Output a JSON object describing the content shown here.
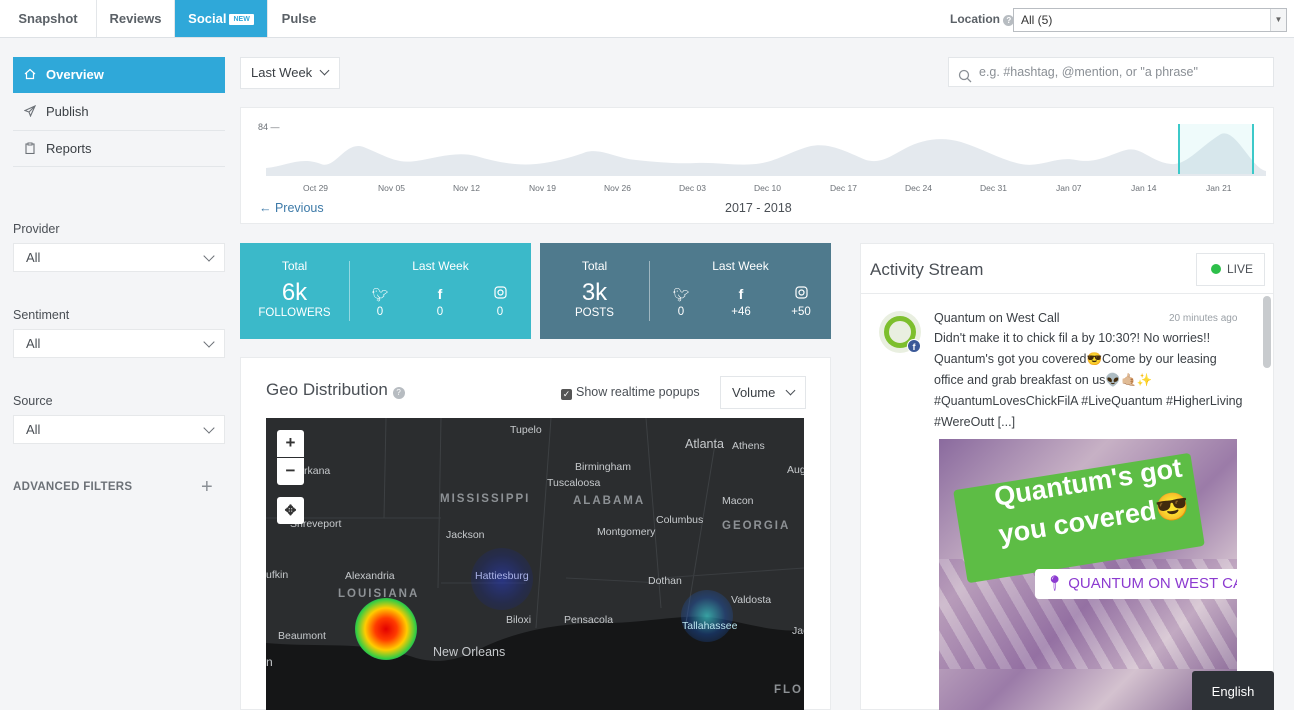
{
  "top_nav": {
    "tabs": [
      {
        "label": "Snapshot"
      },
      {
        "label": "Reviews"
      },
      {
        "label": "Social",
        "badge": "NEW"
      },
      {
        "label": "Pulse"
      }
    ],
    "active_tab": "Social",
    "location_label": "Location",
    "location_value": "All (5)"
  },
  "sidebar": {
    "items": [
      {
        "label": "Overview",
        "icon": "home-icon"
      },
      {
        "label": "Publish",
        "icon": "paper-plane-icon"
      },
      {
        "label": "Reports",
        "icon": "clipboard-icon"
      }
    ],
    "filters": [
      {
        "label": "Provider",
        "value": "All"
      },
      {
        "label": "Sentiment",
        "value": "All"
      },
      {
        "label": "Source",
        "value": "All"
      }
    ],
    "advanced_filters": "ADVANCED FILTERS"
  },
  "toolbar": {
    "period": "Last Week",
    "search_placeholder": "e.g. #hashtag, @mention, or \"a phrase\""
  },
  "timeline": {
    "y_max_label": "84",
    "dates": [
      "Oct 29",
      "Nov 05",
      "Nov 12",
      "Nov 19",
      "Nov 26",
      "Dec 03",
      "Dec 10",
      "Dec 17",
      "Dec 24",
      "Dec 31",
      "Jan 07",
      "Jan 14",
      "Jan 21"
    ],
    "previous": "← Previous",
    "range": "2017 - 2018"
  },
  "followers_card": {
    "total_label": "Total",
    "total_value": "6k",
    "total_unit": "FOLLOWERS",
    "last_week_label": "Last Week",
    "twitter": "0",
    "facebook": "0",
    "instagram": "0",
    "color": "#3bb9c9"
  },
  "posts_card": {
    "total_label": "Total",
    "total_value": "3k",
    "total_unit": "POSTS",
    "last_week_label": "Last Week",
    "twitter": "0",
    "facebook": "+46",
    "instagram": "+50",
    "color": "#4f7a8d"
  },
  "geo": {
    "title": "Geo Distribution",
    "show_popups": "Show realtime popups",
    "metric": "Volume",
    "labels": {
      "tupelo": "Tupelo",
      "atlanta": "Atlanta",
      "athens": "Athens",
      "birmingham": "Birmingham",
      "tuscaloosa": "Tuscaloosa",
      "arkana": "rkana",
      "mississippi": "MISSISSIPPI",
      "alabama": "ALABAMA",
      "macon": "Macon",
      "aug": "Aug",
      "shreveport": "Shreveport",
      "jackson": "Jackson",
      "montgomery": "Montgomery",
      "columbus": "Columbus",
      "georgia": "GEORGIA",
      "ufkin": "ufkin",
      "alexandria": "Alexandria",
      "hattiesburg": "Hattiesburg",
      "dothan": "Dothan",
      "louisiana": "LOUISIANA",
      "valdosta": "Valdosta",
      "beaumont": "Beaumont",
      "biloxi": "Biloxi",
      "pensacola": "Pensacola",
      "tallahassee": "Tallahassee",
      "jac": "Jac",
      "new_orleans": "New Orleans",
      "flo": "FLO",
      "n": "n"
    }
  },
  "activity": {
    "title": "Activity Stream",
    "live": "LIVE",
    "author": "Quantum on West Call",
    "time": "20 minutes ago",
    "text_lines": [
      "Didn't make it to chick fil a by 10:30?! No worries!!",
      "Quantum's got you covered😎Come by our leasing",
      "office and grab breakfast on us👽🤙🏼✨",
      "#QuantumLovesChickFilA #LiveQuantum #HigherLiving",
      "#WereOutt [...]"
    ],
    "image_caption_line1": "Quantum's got",
    "image_caption_line2": "you covered😎",
    "image_location": "QUANTUM ON WEST CALL"
  },
  "language": "English"
}
